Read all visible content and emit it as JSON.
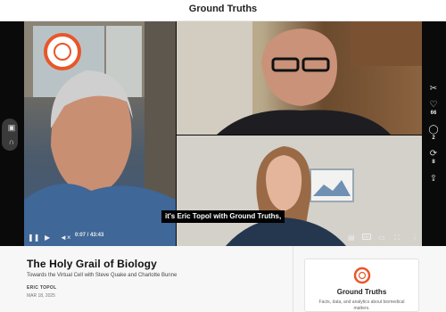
{
  "header": {
    "title": "Ground Truths"
  },
  "video": {
    "caption": "it's Eric Topol with Ground Truths,",
    "time": "0:07 / 43:43",
    "cc_label": "CC"
  },
  "side_actions": {
    "like_count": "66",
    "comment_count": "2",
    "restack_count": "8"
  },
  "article": {
    "title": "The Holy Grail of Biology",
    "subtitle": "Towards the Virtual Cell with Steve Quake and Charlotte Bunne",
    "author": "ERIC TOPOL",
    "date": "MAR 18, 2025"
  },
  "publication_card": {
    "name": "Ground Truths",
    "description": "Facts, data, and analytics about biomedical matters."
  },
  "colors": {
    "brand": "#e8562a",
    "stage": "#0a0a0a"
  },
  "icons": [
    "camera-icon",
    "headphones-icon",
    "scissors-icon",
    "heart-icon",
    "comment-icon",
    "restack-icon",
    "share-icon",
    "play-icon",
    "next-icon",
    "mute-icon",
    "transcript-icon",
    "cc-icon",
    "settings-icon",
    "pip-icon",
    "fullscreen-icon",
    "more-icon"
  ]
}
